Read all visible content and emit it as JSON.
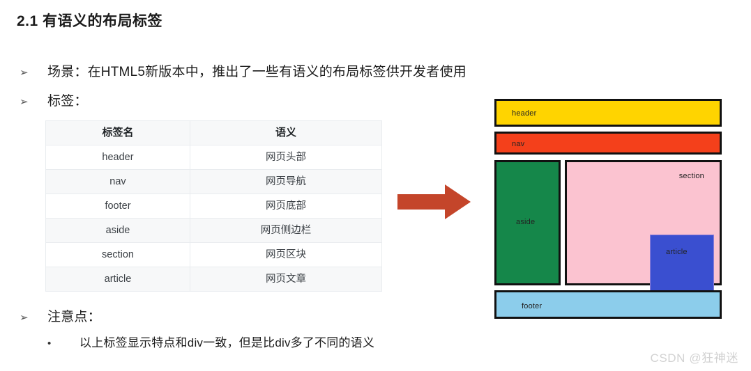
{
  "page": {
    "title": "2.1 有语义的布局标签"
  },
  "bullets": {
    "marker": "➢",
    "sub_marker": "•",
    "scenario": "场景：在HTML5新版本中，推出了一些有语义的布局标签供开发者使用",
    "tags": "标签：",
    "notes": "注意点：",
    "note_item": "以上标签显示特点和div一致，但是比div多了不同的语义"
  },
  "table": {
    "headers": [
      "标签名",
      "语义"
    ],
    "rows": [
      [
        "header",
        "网页头部"
      ],
      [
        "nav",
        "网页导航"
      ],
      [
        "footer",
        "网页底部"
      ],
      [
        "aside",
        "网页侧边栏"
      ],
      [
        "section",
        "网页区块"
      ],
      [
        "article",
        "网页文章"
      ]
    ]
  },
  "arrow": {
    "name": "right-arrow",
    "color": "#C4452A"
  },
  "diagram": {
    "boxes": [
      {
        "key": "header",
        "label": "header",
        "color": "#FFD400"
      },
      {
        "key": "nav",
        "label": "nav",
        "color": "#F4401B"
      },
      {
        "key": "aside",
        "label": "aside",
        "color": "#15874A"
      },
      {
        "key": "section",
        "label": "section",
        "color": "#FBC3D0"
      },
      {
        "key": "article",
        "label": "article",
        "color": "#3A4FD0"
      },
      {
        "key": "footer",
        "label": "footer",
        "color": "#8CCDEB"
      }
    ]
  },
  "watermark": {
    "text": "CSDN @狂神迷"
  }
}
